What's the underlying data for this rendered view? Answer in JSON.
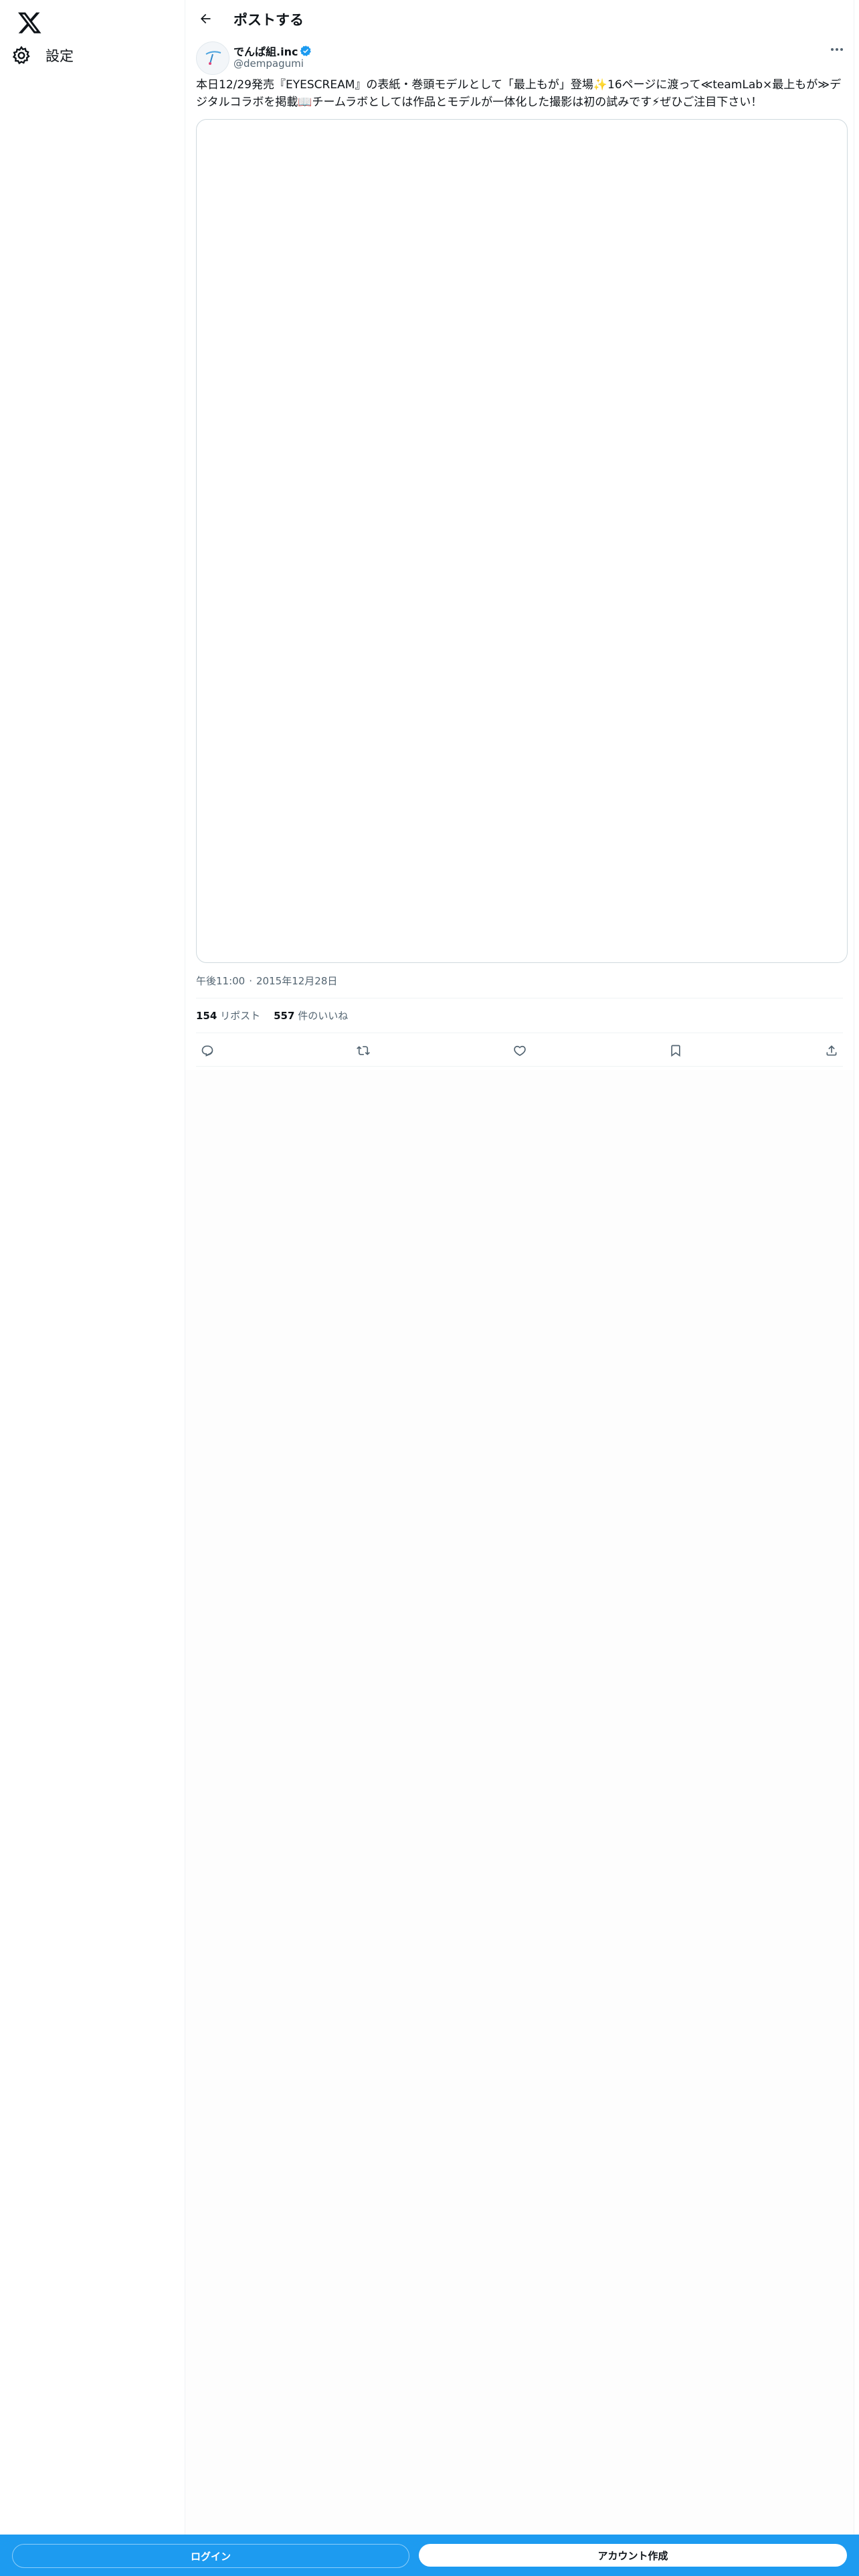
{
  "sidebar": {
    "logo_icon": "x-logo-icon",
    "items": [
      {
        "label": "設定",
        "icon": "gear-icon"
      }
    ]
  },
  "header": {
    "back_icon": "arrow-left-icon",
    "title": "ポストする"
  },
  "post": {
    "display_name": "でんぱ組.inc",
    "handle": "@dempagumi",
    "verified": true,
    "text": "本日12/29発売『EYESCREAM』の表紙・巻頭モデルとして「最上もが」登場✨16ページに渡って≪teamLab×最上もが≫デジタルコラボを掲載📖チームラボとしては作品とモデルが一体化した撮影は初の試みです⚡ぜひご注目下さい！",
    "time": "午後11:00",
    "date": "2015年12月28日",
    "separator": "·",
    "reposts_count": "154",
    "reposts_label": "リポスト",
    "likes_count": "557",
    "likes_label": "件のいいね"
  },
  "bottom_bar": {
    "login_label": "ログイン",
    "signup_label": "アカウント作成"
  },
  "colors": {
    "accent": "#1d9bf0",
    "text_primary": "#0f1419",
    "text_secondary": "#536471",
    "border": "#eff3f4"
  }
}
